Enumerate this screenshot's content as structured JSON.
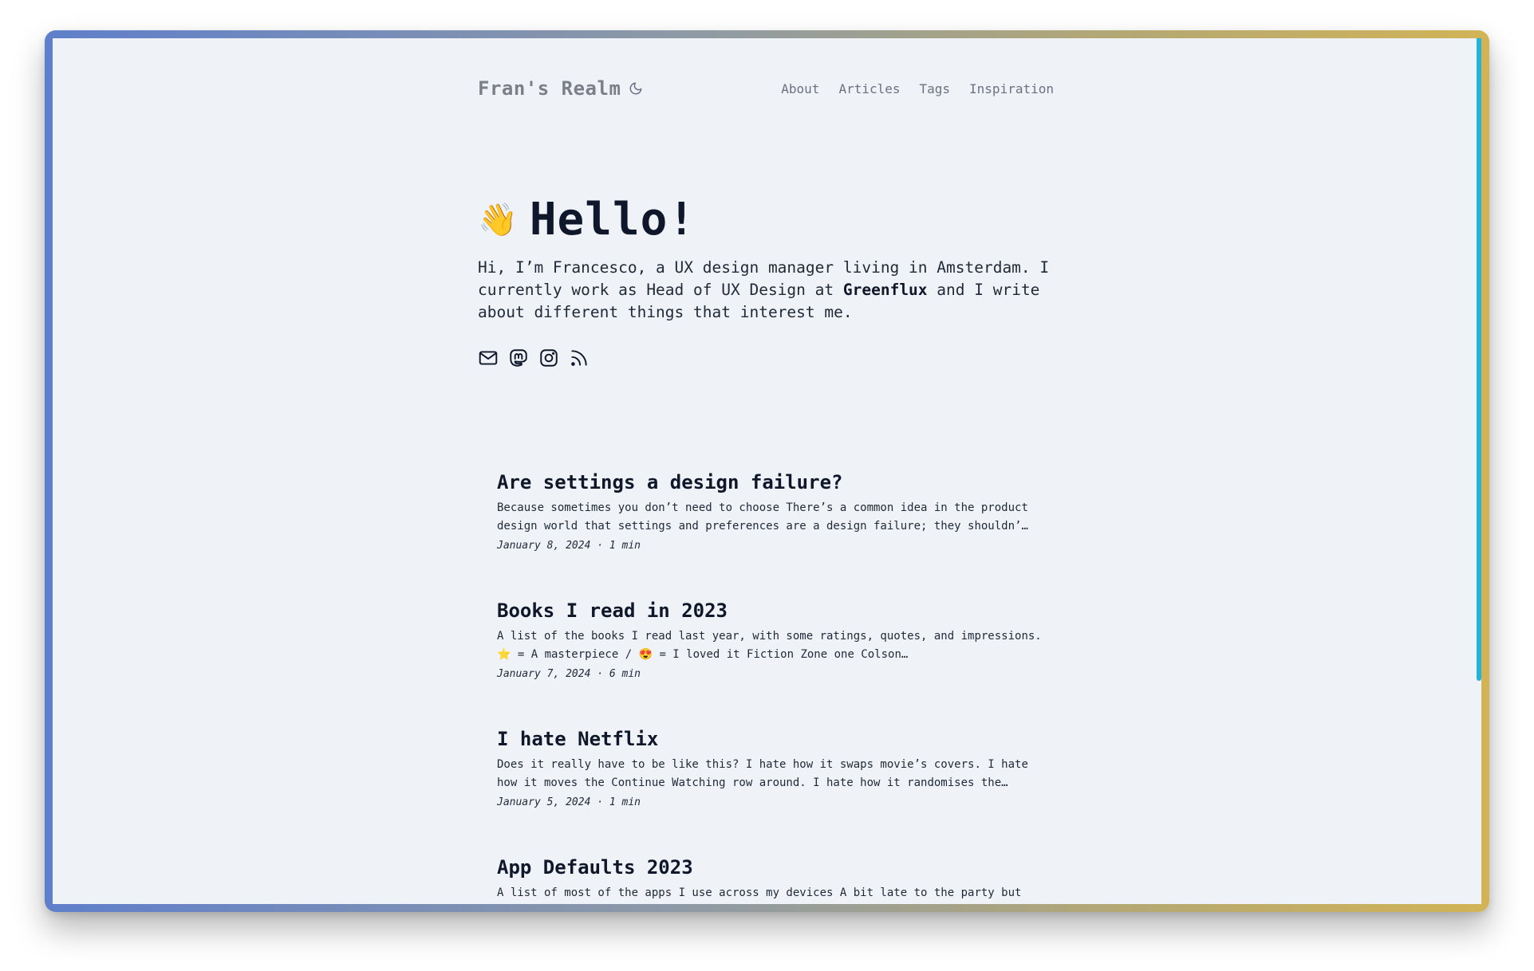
{
  "site": {
    "title": "Fran's Realm",
    "theme_toggle_icon": "moon-icon"
  },
  "nav": {
    "items": [
      {
        "label": "About"
      },
      {
        "label": "Articles"
      },
      {
        "label": "Tags"
      },
      {
        "label": "Inspiration"
      }
    ]
  },
  "hero": {
    "emoji": "👋",
    "heading": "Hello!",
    "intro_before": "Hi, I’m Francesco, a UX design manager living in Amsterdam. I currently work as Head of UX Design at ",
    "intro_company": "Greenflux",
    "intro_after": " and I write about different things that interest me."
  },
  "socials": [
    {
      "icon": "mail-icon"
    },
    {
      "icon": "mastodon-icon"
    },
    {
      "icon": "instagram-icon"
    },
    {
      "icon": "rss-icon"
    }
  ],
  "articles": [
    {
      "title": "Are settings a design failure?",
      "excerpt": "Because sometimes you don’t need to choose There’s a common idea in the product design world that settings and preferences are a design failure; they shouldn’…",
      "meta": "January 8, 2024 · 1 min"
    },
    {
      "title": "Books I read in 2023",
      "excerpt": "A list of the books I read last year, with some ratings, quotes, and impressions. ⭐️ = A masterpiece / 😍 = I loved it Fiction Zone one Colson…",
      "meta": "January 7, 2024 · 6 min"
    },
    {
      "title": "I hate Netflix",
      "excerpt": "Does it really have to be like this? I hate how it swaps movie’s covers. I hate how it moves the Continue Watching row around. I hate how it randomises the…",
      "meta": "January 5, 2024 · 1 min"
    },
    {
      "title": "App Defaults 2023",
      "excerpt": "A list of most of the apps I use across my devices A bit late to the party but",
      "meta": ""
    }
  ],
  "colors": {
    "background": "#eff2f7",
    "accent_scrollbar": "#22b3dd",
    "text_dark": "#0f172a",
    "text_muted": "#6b7280"
  }
}
